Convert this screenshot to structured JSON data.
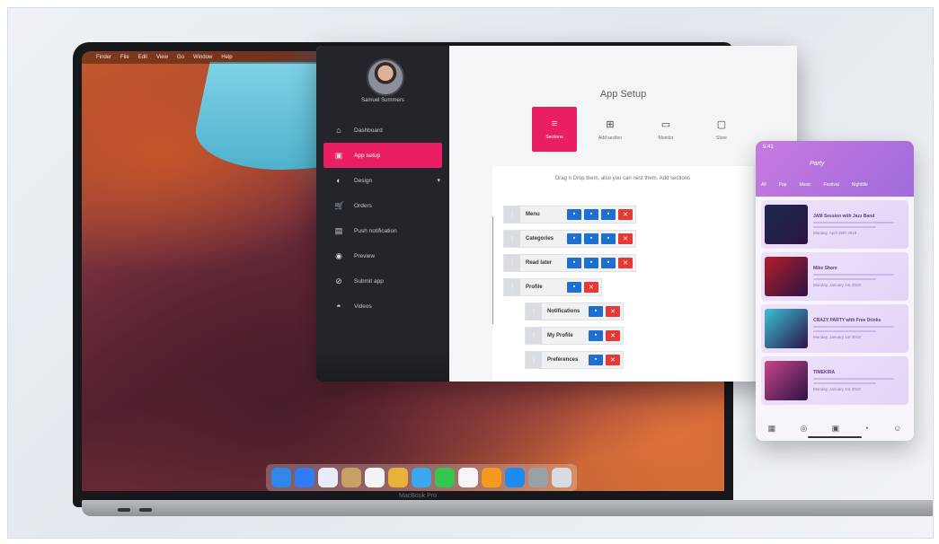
{
  "laptop": {
    "menubar": [
      "Finder",
      "File",
      "Edit",
      "View",
      "Go",
      "Window",
      "Help"
    ],
    "brand_label": "MacBook Pro",
    "dock_apps": [
      {
        "name": "finder",
        "color": "#2d88e8"
      },
      {
        "name": "safari",
        "color": "#2f7cf6"
      },
      {
        "name": "photos-viewer",
        "color": "#e8eef7"
      },
      {
        "name": "notes",
        "color": "#c8a065"
      },
      {
        "name": "calendar",
        "color": "#f3f3f3"
      },
      {
        "name": "chrome",
        "color": "#e8b23a"
      },
      {
        "name": "mail",
        "color": "#3aa7ee"
      },
      {
        "name": "messages",
        "color": "#35c64f"
      },
      {
        "name": "music",
        "color": "#f5f5f7"
      },
      {
        "name": "books",
        "color": "#f59a1f"
      },
      {
        "name": "app-store",
        "color": "#1d8cf0"
      },
      {
        "name": "preferences",
        "color": "#9aa0a8"
      },
      {
        "name": "trash",
        "color": "#d8dbe0"
      }
    ]
  },
  "app": {
    "user_name": "Samuel Summers",
    "nav": [
      {
        "icon": "home-icon",
        "glyph": "⌂",
        "label": "Dashboard"
      },
      {
        "icon": "setup-icon",
        "glyph": "▣",
        "label": "App setup",
        "active": true
      },
      {
        "icon": "design-icon",
        "glyph": "◐",
        "label": "Design"
      },
      {
        "icon": "cart-icon",
        "glyph": "🛒",
        "label": "Orders"
      },
      {
        "icon": "notification-icon",
        "glyph": "▤",
        "label": "Push notification"
      },
      {
        "icon": "eye-icon",
        "glyph": "◉",
        "label": "Preview"
      },
      {
        "icon": "submit-icon",
        "glyph": "⊘",
        "label": "Submit app"
      },
      {
        "icon": "video-icon",
        "glyph": "◓",
        "label": "Videos"
      }
    ],
    "title": "App Setup",
    "steps": [
      {
        "icon": "sections-icon",
        "glyph": "≡",
        "label": "Sections",
        "active": true
      },
      {
        "icon": "add-section-icon",
        "glyph": "⊞",
        "label": "Add section"
      },
      {
        "icon": "monitor-icon",
        "glyph": "▭",
        "label": "Monitor"
      },
      {
        "icon": "store-icon",
        "glyph": "▢",
        "label": "Store"
      }
    ],
    "builder_hint": "Drag n Drop them, also you can nest them. Add sections",
    "tree": [
      {
        "label": "Menu",
        "indent": 0,
        "actions": [
          "blue",
          "blue",
          "blue",
          "red"
        ]
      },
      {
        "label": "Categories",
        "indent": 0,
        "actions": [
          "blue",
          "blue",
          "blue",
          "red"
        ]
      },
      {
        "label": "Read later",
        "indent": 0,
        "actions": [
          "blue",
          "blue",
          "blue",
          "red"
        ]
      },
      {
        "label": "Profile",
        "indent": 0,
        "actions": [
          "blue",
          "red"
        ]
      },
      {
        "label": "Notifications",
        "indent": 1,
        "actions": [
          "blue",
          "red"
        ]
      },
      {
        "label": "My Profile",
        "indent": 1,
        "actions": [
          "blue",
          "red"
        ]
      },
      {
        "label": "Preferences",
        "indent": 1,
        "actions": [
          "blue",
          "red"
        ]
      }
    ]
  },
  "phone": {
    "time": "9:41",
    "brand": "Party",
    "tabs": [
      "All",
      "Pop",
      "Music",
      "Festival",
      "Nightlife"
    ],
    "cards": [
      {
        "title": "JAM Session with Jazz Band",
        "date": "Monday, April 26th 2019",
        "color": "#1b2a4d"
      },
      {
        "title": "Mike Shore",
        "date": "Monday, January 1st 2019",
        "color": "#b51d2a"
      },
      {
        "title": "CRAZY PARTY with Free Drinks",
        "date": "Monday, January 1st 2019",
        "color": "#3cc0d6"
      },
      {
        "title": "TIMEKIRA",
        "date": "Monday, January 1st 2019",
        "color": "#c9448a"
      }
    ],
    "nav_icons": [
      "calendar-icon",
      "location-icon",
      "ticket-icon",
      "bell-icon",
      "user-icon"
    ]
  }
}
